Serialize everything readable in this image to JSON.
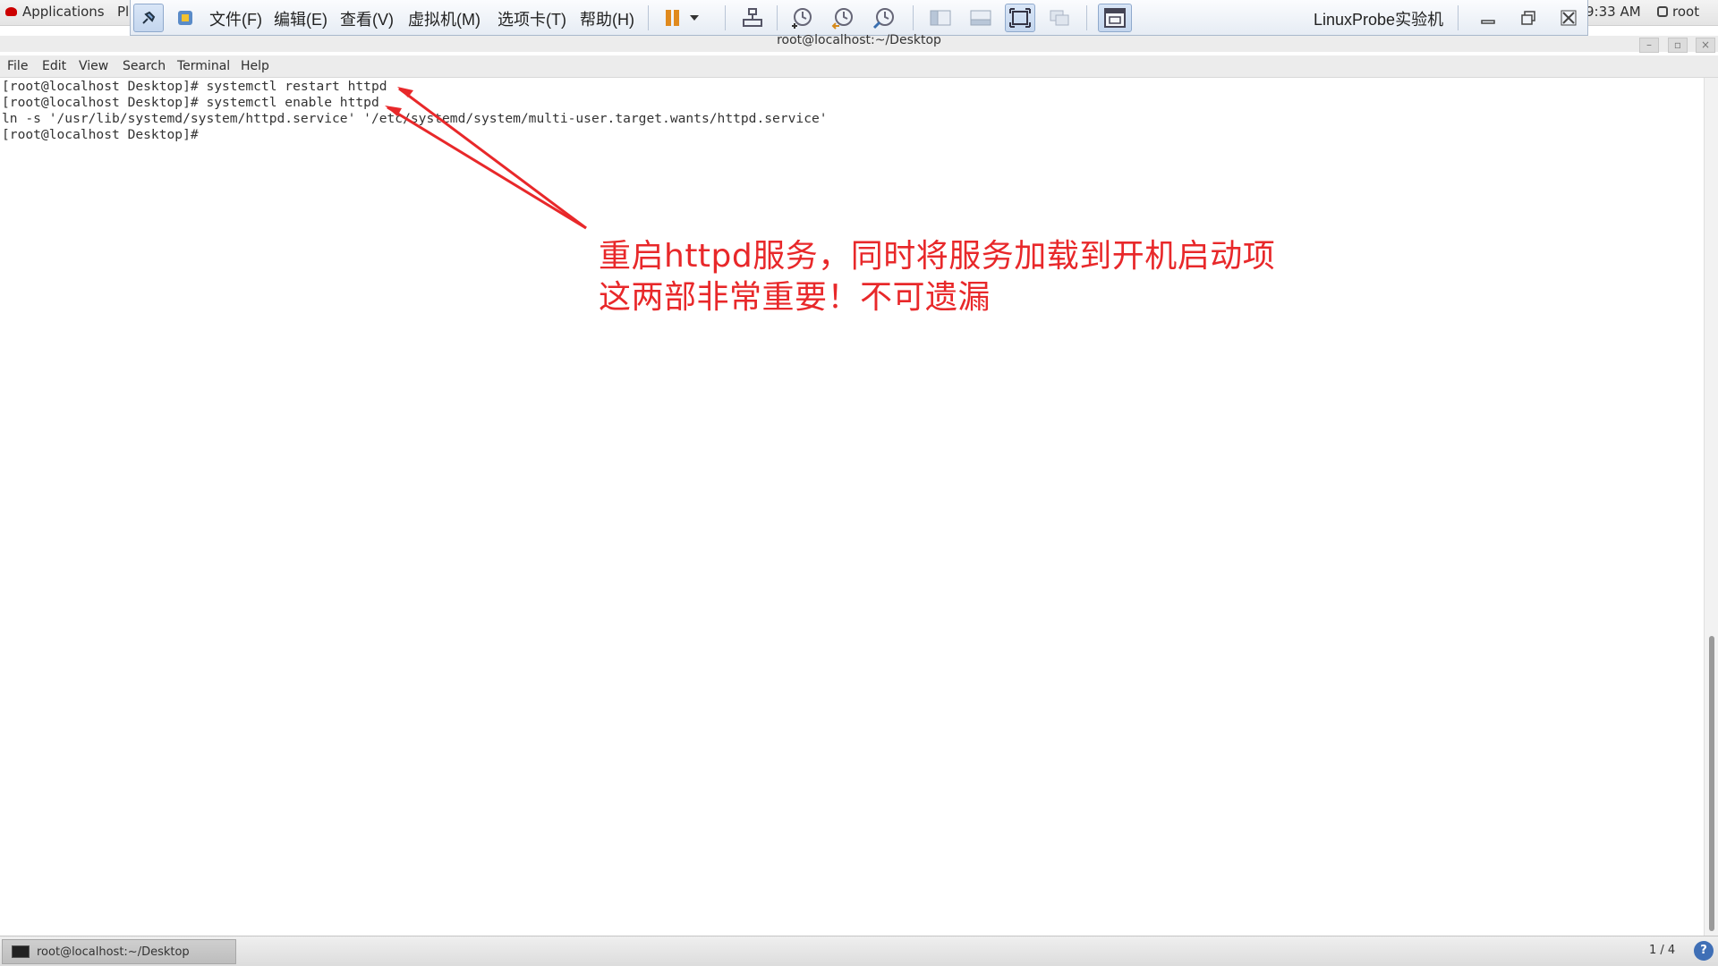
{
  "topbar": {
    "applications": "Applications",
    "places": "Pl",
    "clock": "9:33 AM",
    "user": "root"
  },
  "vmware": {
    "menus": [
      "文件(F)",
      "编辑(E)",
      "查看(V)",
      "虚拟机(M)",
      "选项卡(T)",
      "帮助(H)"
    ],
    "title": "LinuxProbe实验机"
  },
  "terminal": {
    "window_title": "root@localhost:~/Desktop",
    "menu": [
      "File",
      "Edit",
      "View",
      "Search",
      "Terminal",
      "Help"
    ],
    "lines": [
      "[root@localhost Desktop]# systemctl restart httpd",
      "[root@localhost Desktop]# systemctl enable httpd",
      "ln -s '/usr/lib/systemd/system/httpd.service' '/etc/systemd/system/multi-user.target.wants/httpd.service'",
      "[root@localhost Desktop]# "
    ]
  },
  "annotation": {
    "line1": "重启httpd服务，同时将服务加载到开机启动项",
    "line2": "这两部非常重要！不可遗漏",
    "color": "#e8282a"
  },
  "taskbar": {
    "task_label": "root@localhost:~/Desktop",
    "workspace": "1 / 4",
    "help": "?"
  }
}
